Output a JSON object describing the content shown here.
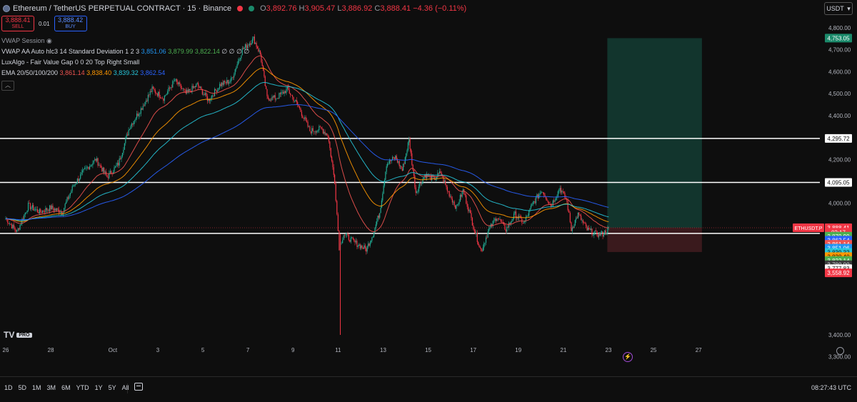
{
  "header": {
    "title": "Ethereum / TetherUS PERPETUAL CONTRACT · 15 · Binance",
    "ohlc": [
      {
        "k": "O",
        "v": "3,892.76"
      },
      {
        "k": "H",
        "v": "3,905.47"
      },
      {
        "k": "L",
        "v": "3,886.92"
      },
      {
        "k": "C",
        "v": "3,888.41"
      }
    ],
    "change": "−4.36 (−0.11%)",
    "currency": "USDT"
  },
  "trade": {
    "sell_price": "3,888.41",
    "sell_label": "SELL",
    "spread": "0.01",
    "buy_price": "3,888.42",
    "buy_label": "BUY"
  },
  "indicators": {
    "vwap_session": "VWAP Session",
    "vwap_aa_name": "VWAP AA Auto hlc3 14 Standard Deviation 1 2 3",
    "vwap_aa_v1": "3,851.06",
    "vwap_aa_v2": "3,879.99",
    "vwap_aa_v3": "3,822.14",
    "vwap_aa_tail": "∅ ∅ ∅ ∅",
    "luxalgo": "LuxAlgo - Fair Value Gap 0 0 20 Top Right Small",
    "ema_name": "EMA 20/50/100/200",
    "ema_v1": "3,861.14",
    "ema_v2": "3,838.40",
    "ema_v3": "3,839.32",
    "ema_v4": "3,862.54"
  },
  "colors": {
    "up": "#22ab94",
    "down": "#f23645",
    "ema20": "#ef5350",
    "ema50": "#ff9800",
    "ema100": "#26c6da",
    "ema200": "#2962ff",
    "vwap": "#4caf50",
    "tp_zone": "#12352d",
    "sl_zone": "#3a1a1d"
  },
  "price_axis": {
    "ticks": [
      "4,800.00",
      "4,700.00",
      "4,600.00",
      "4,500.00",
      "4,400.00",
      "4,200.00",
      "4,000.00",
      "3,400.00",
      "3,300.00"
    ],
    "tick_values": [
      4800,
      4700,
      4600,
      4500,
      4400,
      4200,
      4000,
      3400,
      3300
    ],
    "labels": [
      {
        "text": "4,753.05",
        "value": 4753.05,
        "bg": "#1b8a6b",
        "fg": "#ffffff"
      },
      {
        "text": "4,295.72",
        "value": 4295.72,
        "bg": "#ffffff",
        "fg": "#111111"
      },
      {
        "text": "4,095.05",
        "value": 4095.05,
        "bg": "#ffffff",
        "fg": "#111111"
      },
      {
        "text": "3,888.41",
        "value": 3888.41,
        "bg": "#f23645",
        "fg": "#ffffff"
      },
      {
        "text": "02:17",
        "value": 3868,
        "bg": "#f23645",
        "fg": "#ffffff"
      },
      {
        "text": "3,879.99",
        "value": 3850,
        "bg": "#4caf50",
        "fg": "#ffffff"
      },
      {
        "text": "3,862.54",
        "value": 3832,
        "bg": "#2962ff",
        "fg": "#ffffff"
      },
      {
        "text": "3,861.14",
        "value": 3813,
        "bg": "#ef5350",
        "fg": "#ffffff"
      },
      {
        "text": "3,851.06",
        "value": 3795,
        "bg": "#2196f3",
        "fg": "#ffffff"
      },
      {
        "text": "3,839.32",
        "value": 3776,
        "bg": "#26c6da",
        "fg": "#111111"
      },
      {
        "text": "3,838.40",
        "value": 3757,
        "bg": "#ff9800",
        "fg": "#111111"
      },
      {
        "text": "3,822.14",
        "value": 3739,
        "bg": "#4caf50",
        "fg": "#ffffff"
      },
      {
        "text": "3,780.00",
        "value": 3720,
        "bg": "#3a3a3a",
        "fg": "#d1d4dc"
      },
      {
        "text": "3,777.83",
        "value": 3702,
        "bg": "#ffffff",
        "fg": "#111111"
      },
      {
        "text": "3,558.92",
        "value": 3683,
        "bg": "#f23645",
        "fg": "#ffffff"
      }
    ],
    "symbol_tag": "ETHUSDT.P"
  },
  "time_axis": {
    "ticks": [
      {
        "label": "26",
        "day": 0
      },
      {
        "label": "28",
        "day": 2
      },
      {
        "label": "Oct",
        "day": 4.75
      },
      {
        "label": "3",
        "day": 6.75
      },
      {
        "label": "5",
        "day": 8.75
      },
      {
        "label": "7",
        "day": 10.75
      },
      {
        "label": "9",
        "day": 12.75
      },
      {
        "label": "11",
        "day": 14.75
      },
      {
        "label": "13",
        "day": 16.75
      },
      {
        "label": "15",
        "day": 18.75
      },
      {
        "label": "17",
        "day": 20.75
      },
      {
        "label": "19",
        "day": 22.75
      },
      {
        "label": "21",
        "day": 24.75
      },
      {
        "label": "23",
        "day": 26.75
      },
      {
        "label": "25",
        "day": 28.75
      },
      {
        "label": "27",
        "day": 30.75
      }
    ]
  },
  "horizontal_lines": [
    4295.72,
    4095.05,
    3862.54
  ],
  "position": {
    "entry": 3888.41,
    "target": 4753.05,
    "stop": 3777.83,
    "start_day": 26.7,
    "end_day": 30.9
  },
  "price_path": [
    [
      0,
      3930
    ],
    [
      0.5,
      3870
    ],
    [
      1,
      3990
    ],
    [
      1.5,
      3960
    ],
    [
      2,
      3980
    ],
    [
      2.5,
      3960
    ],
    [
      3,
      4080
    ],
    [
      3.5,
      4150
    ],
    [
      4,
      4200
    ],
    [
      4.5,
      4120
    ],
    [
      5,
      4180
    ],
    [
      5.5,
      4350
    ],
    [
      6,
      4430
    ],
    [
      6.5,
      4520
    ],
    [
      7,
      4480
    ],
    [
      7.5,
      4560
    ],
    [
      8,
      4500
    ],
    [
      8.5,
      4540
    ],
    [
      9,
      4470
    ],
    [
      9.5,
      4540
    ],
    [
      10,
      4560
    ],
    [
      10.5,
      4700
    ],
    [
      11,
      4750
    ],
    [
      11.3,
      4680
    ],
    [
      11.6,
      4480
    ],
    [
      12,
      4480
    ],
    [
      12.5,
      4520
    ],
    [
      13,
      4440
    ],
    [
      13.5,
      4330
    ],
    [
      14,
      4340
    ],
    [
      14.3,
      4310
    ],
    [
      14.6,
      4100
    ],
    [
      14.8,
      3800
    ],
    [
      15,
      3860
    ],
    [
      15.5,
      3820
    ],
    [
      16,
      3790
    ],
    [
      16.3,
      3860
    ],
    [
      16.6,
      3960
    ],
    [
      16.9,
      4180
    ],
    [
      17.3,
      4210
    ],
    [
      17.6,
      4150
    ],
    [
      17.9,
      4290
    ],
    [
      18.2,
      4050
    ],
    [
      18.6,
      4130
    ],
    [
      19,
      4110
    ],
    [
      19.3,
      4140
    ],
    [
      19.6,
      4060
    ],
    [
      20,
      3980
    ],
    [
      20.3,
      4060
    ],
    [
      20.8,
      3880
    ],
    [
      21.1,
      3780
    ],
    [
      21.4,
      3870
    ],
    [
      21.8,
      3940
    ],
    [
      22.2,
      3880
    ],
    [
      22.6,
      3950
    ],
    [
      23,
      3910
    ],
    [
      23.4,
      4000
    ],
    [
      23.8,
      4060
    ],
    [
      24.2,
      3990
    ],
    [
      24.6,
      4070
    ],
    [
      24.9,
      4010
    ],
    [
      25.1,
      3880
    ],
    [
      25.4,
      3950
    ],
    [
      25.8,
      3880
    ],
    [
      26.2,
      3860
    ],
    [
      26.5,
      3860
    ],
    [
      26.8,
      3888
    ]
  ],
  "range_buttons": [
    "1D",
    "5D",
    "1M",
    "3M",
    "6M",
    "YTD",
    "1Y",
    "5Y",
    "All"
  ],
  "clock": "08:27:43 UTC",
  "logo": {
    "text": "TV",
    "badge": "PRO"
  }
}
